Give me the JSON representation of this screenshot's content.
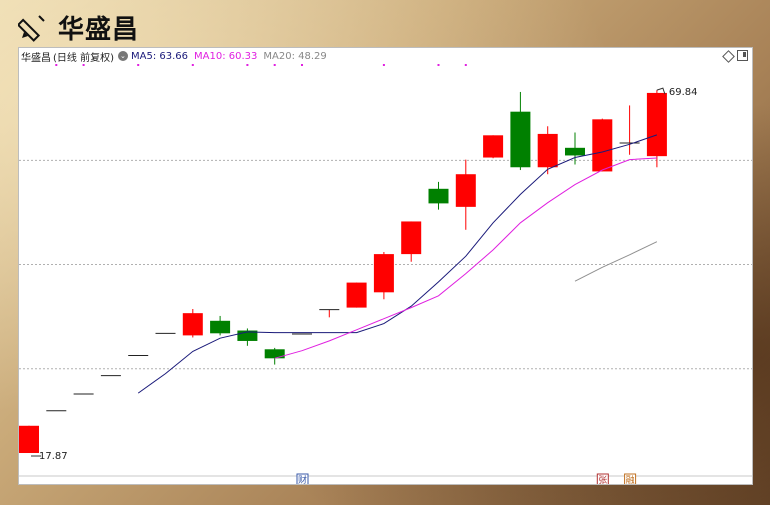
{
  "page": {
    "title": "华盛昌"
  },
  "legend": {
    "name": "华盛昌",
    "period": "(日线 前复权)",
    "ma5": "MA5: 63.66",
    "ma10": "MA10: 60.33",
    "ma20": "MA20: 48.29"
  },
  "colors": {
    "up": "#ff0000",
    "down": "#008000",
    "ma5": "#1a1a7a",
    "ma10": "#e020e0",
    "ma20": "#909090",
    "grid": "#b0b0b0"
  },
  "chart_data": {
    "type": "candlestick",
    "ylim": [
      16.0,
      73.0
    ],
    "grid_y": [
      30,
      45,
      60
    ],
    "candles": [
      {
        "o": 17.87,
        "h": 21.79,
        "l": 17.87,
        "c": 21.79
      },
      {
        "o": 23.96,
        "h": 23.96,
        "l": 23.96,
        "c": 23.96
      },
      {
        "o": 26.36,
        "h": 26.36,
        "l": 26.36,
        "c": 26.36
      },
      {
        "o": 29.0,
        "h": 29.0,
        "l": 29.0,
        "c": 29.0
      },
      {
        "o": 31.9,
        "h": 31.9,
        "l": 31.9,
        "c": 31.9
      },
      {
        "o": 35.09,
        "h": 35.09,
        "l": 35.09,
        "c": 35.09
      },
      {
        "o": 34.8,
        "h": 38.6,
        "l": 34.5,
        "c": 38.0
      },
      {
        "o": 36.9,
        "h": 37.6,
        "l": 34.8,
        "c": 35.1
      },
      {
        "o": 35.5,
        "h": 35.8,
        "l": 33.3,
        "c": 34.0
      },
      {
        "o": 32.8,
        "h": 33.0,
        "l": 30.6,
        "c": 31.5
      },
      {
        "o": 35.0,
        "h": 35.0,
        "l": 35.0,
        "c": 35.0
      },
      {
        "o": 38.5,
        "h": 38.5,
        "l": 37.4,
        "c": 38.5
      },
      {
        "o": 38.8,
        "h": 42.4,
        "l": 38.8,
        "c": 42.4
      },
      {
        "o": 41.0,
        "h": 46.8,
        "l": 40.0,
        "c": 46.5
      },
      {
        "o": 46.5,
        "h": 51.2,
        "l": 45.4,
        "c": 51.2
      },
      {
        "o": 55.9,
        "h": 56.9,
        "l": 52.9,
        "c": 53.8
      },
      {
        "o": 53.3,
        "h": 60.1,
        "l": 50.0,
        "c": 58.0
      },
      {
        "o": 60.4,
        "h": 63.6,
        "l": 60.3,
        "c": 63.6
      },
      {
        "o": 67.0,
        "h": 69.84,
        "l": 58.6,
        "c": 59.0
      },
      {
        "o": 59.0,
        "h": 64.9,
        "l": 58.0,
        "c": 63.8
      },
      {
        "o": 61.8,
        "h": 64.0,
        "l": 59.4,
        "c": 60.7
      },
      {
        "o": 58.4,
        "h": 66.0,
        "l": 58.4,
        "c": 65.9
      },
      {
        "o": 62.5,
        "h": 67.9,
        "l": 60.8,
        "c": 62.5
      },
      {
        "o": 60.6,
        "h": 70.1,
        "l": 59.0,
        "c": 69.7
      }
    ],
    "ma5": [
      null,
      null,
      null,
      null,
      26.5,
      29.3,
      32.5,
      34.4,
      35.3,
      35.2,
      35.2,
      35.2,
      35.2,
      36.5,
      39.0,
      42.5,
      46.2,
      51.0,
      55.1,
      58.7,
      60.4,
      61.2,
      62.3,
      63.66
    ],
    "ma10": [
      null,
      null,
      null,
      null,
      null,
      null,
      null,
      null,
      null,
      31.5,
      32.6,
      34.0,
      35.6,
      37.2,
      38.8,
      40.5,
      43.7,
      47.1,
      51.0,
      53.9,
      56.5,
      58.6,
      60.1,
      60.33
    ],
    "ma20": [
      null,
      null,
      null,
      null,
      null,
      null,
      null,
      null,
      null,
      null,
      null,
      null,
      null,
      null,
      null,
      null,
      null,
      null,
      null,
      null,
      42.6,
      44.6,
      46.4,
      48.29
    ],
    "high_label": "69.84",
    "low_label": "17.87",
    "markers": [
      {
        "index": 10,
        "label": "财",
        "color": "#3a5aa8"
      },
      {
        "index": 21,
        "label": "张",
        "color": "#b03030"
      },
      {
        "index": 22,
        "label": "融",
        "color": "#c07020"
      }
    ],
    "top_dots": [
      1,
      2,
      4,
      6,
      8,
      9,
      10,
      13,
      15,
      16
    ]
  }
}
